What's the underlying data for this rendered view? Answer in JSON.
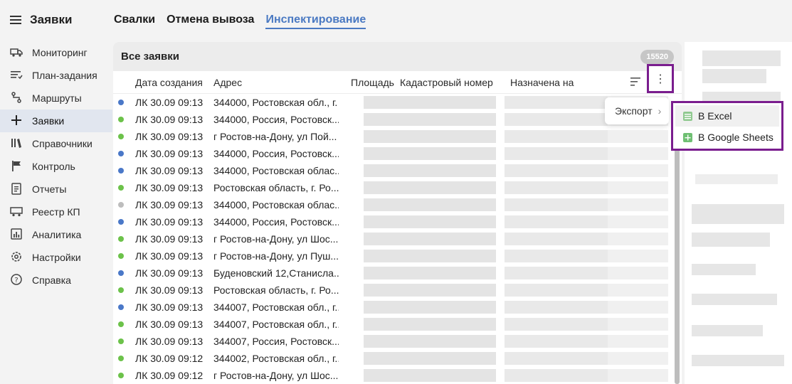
{
  "app": {
    "title": "Заявки"
  },
  "sidebar": {
    "items": [
      {
        "label": "Мониторинг",
        "icon": "truck-icon"
      },
      {
        "label": "План-задания",
        "icon": "list-icon"
      },
      {
        "label": "Маршруты",
        "icon": "route-icon"
      },
      {
        "label": "Заявки",
        "icon": "plus-icon"
      },
      {
        "label": "Справочники",
        "icon": "books-icon"
      },
      {
        "label": "Контроль",
        "icon": "flag-icon"
      },
      {
        "label": "Отчеты",
        "icon": "report-icon"
      },
      {
        "label": "Реестр КП",
        "icon": "registry-icon"
      },
      {
        "label": "Аналитика",
        "icon": "analytics-icon"
      },
      {
        "label": "Настройки",
        "icon": "gear-icon"
      },
      {
        "label": "Справка",
        "icon": "help-icon"
      }
    ],
    "active_index": 3
  },
  "tabs": [
    {
      "label": "Свалки"
    },
    {
      "label": "Отмена вывоза"
    },
    {
      "label": "Инспектирование",
      "active": true
    }
  ],
  "card": {
    "title": "Все заявки",
    "count": "15520",
    "columns": [
      "Дата создания",
      "Адрес",
      "Площадь",
      "Кадастровый номер",
      "Назначена на"
    ],
    "more_label": "⋮"
  },
  "colors": {
    "blue": "#4a78c8",
    "green": "#6cc24a",
    "gray": "#bdbdbd",
    "accent": "#4a79c2",
    "highlight": "#7a1d8e"
  },
  "rows": [
    {
      "status": "blue",
      "date": "ЛК 30.09 09:13",
      "address": "344000, Ростовская обл., г."
    },
    {
      "status": "green",
      "date": "ЛК 30.09 09:13",
      "address": "344000, Россия, Ростовск..."
    },
    {
      "status": "green",
      "date": "ЛК 30.09 09:13",
      "address": "г Ростов-на-Дону, ул Пой..."
    },
    {
      "status": "blue",
      "date": "ЛК 30.09 09:13",
      "address": "344000, Россия, Ростовск..."
    },
    {
      "status": "blue",
      "date": "ЛК 30.09 09:13",
      "address": "344000, Ростовская облас..."
    },
    {
      "status": "green",
      "date": "ЛК 30.09 09:13",
      "address": "Ростовская область, г. Ро..."
    },
    {
      "status": "gray",
      "date": "ЛК 30.09 09:13",
      "address": "344000, Ростовская облас..."
    },
    {
      "status": "blue",
      "date": "ЛК 30.09 09:13",
      "address": "344000, Россия, Ростовск..."
    },
    {
      "status": "green",
      "date": "ЛК 30.09 09:13",
      "address": "г Ростов-на-Дону, ул Шос..."
    },
    {
      "status": "green",
      "date": "ЛК 30.09 09:13",
      "address": "г Ростов-на-Дону, ул Пуш..."
    },
    {
      "status": "blue",
      "date": "ЛК 30.09 09:13",
      "address": "Буденовский 12,Станисла..."
    },
    {
      "status": "green",
      "date": "ЛК 30.09 09:13",
      "address": "Ростовская область, г. Ро..."
    },
    {
      "status": "blue",
      "date": "ЛК 30.09 09:13",
      "address": "344007, Ростовская обл., г..."
    },
    {
      "status": "green",
      "date": "ЛК 30.09 09:13",
      "address": "344007, Ростовская обл., г..."
    },
    {
      "status": "green",
      "date": "ЛК 30.09 09:13",
      "address": "344007, Россия, Ростовск..."
    },
    {
      "status": "green",
      "date": "ЛК 30.09 09:12",
      "address": "344002, Ростовская обл., г..."
    },
    {
      "status": "green",
      "date": "ЛК 30.09 09:12",
      "address": "г Ростов-на-Дону, ул Шос..."
    }
  ],
  "export_menu": {
    "label": "Экспорт",
    "items": [
      {
        "label": "В Excel",
        "icon": "excel-icon"
      },
      {
        "label": "В Google Sheets",
        "icon": "google-sheets-icon"
      }
    ]
  }
}
